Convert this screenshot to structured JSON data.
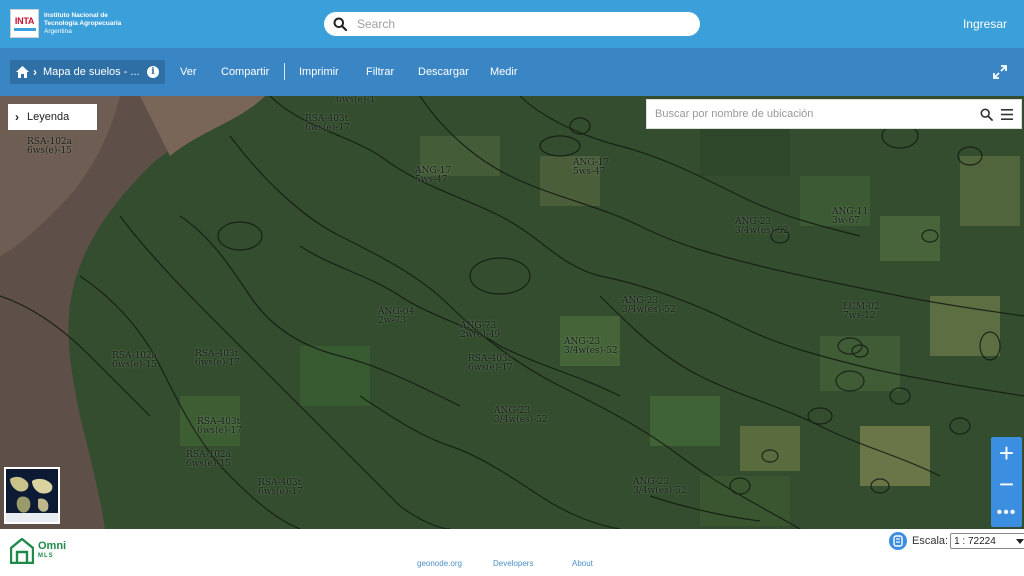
{
  "header": {
    "logo": {
      "badge": "INTA",
      "line1": "Instituto Nacional de",
      "line2": "Tecnología Agropecuaria",
      "line3": "Argentina"
    },
    "search_placeholder": "Search",
    "login_label": "Ingresar"
  },
  "toolbar": {
    "breadcrumb_title": "Mapa de suelos - ...",
    "menu": [
      "Ver",
      "Compartir",
      "Imprimir",
      "Filtrar",
      "Descargar",
      "Medir"
    ]
  },
  "map": {
    "legend_label": "Leyenda",
    "location_search_placeholder": "Buscar por nombre de ubicación",
    "soil_labels": [
      "RSA-102a\n6ws(e)-15",
      "6ws(e)-1",
      "RSA-403t\n6ws(e)-17",
      "ANG-17\n5ws-47",
      "ANG-17\n5ws-47",
      "ANG-23\n3/4w(es)-52",
      "ANG-11\n3w-67",
      "ANG-04\n2w-73",
      "ANG-73\n2w(e)-49",
      "RSA-403t\n6ws(e)-17",
      "ANG-23\n3/4w(es)-52",
      "ANG-23\n3/4w(es)-52",
      "LCM-02\n7ws-12",
      "RSA-102a\n6ws(e)-15",
      "RSA-403t\n6ws(e)-17",
      "ANG-23\n3/4w(es)-52",
      "RSA-403t\n6ws(e)-17",
      "RSA-102a\n6ws(e)-15",
      "RSA-403t\n6ws(e)-17",
      "ANG-23\n3/4w(es)-52"
    ],
    "zoom_in": "+",
    "zoom_out": "−",
    "more": "•••"
  },
  "footer": {
    "brand_line1": "Omni",
    "brand_line2": "MLS",
    "links": [
      "geonode.org",
      "Developers",
      "About"
    ],
    "scale_label": "Escala:",
    "scale_value": "1 : 72224"
  }
}
